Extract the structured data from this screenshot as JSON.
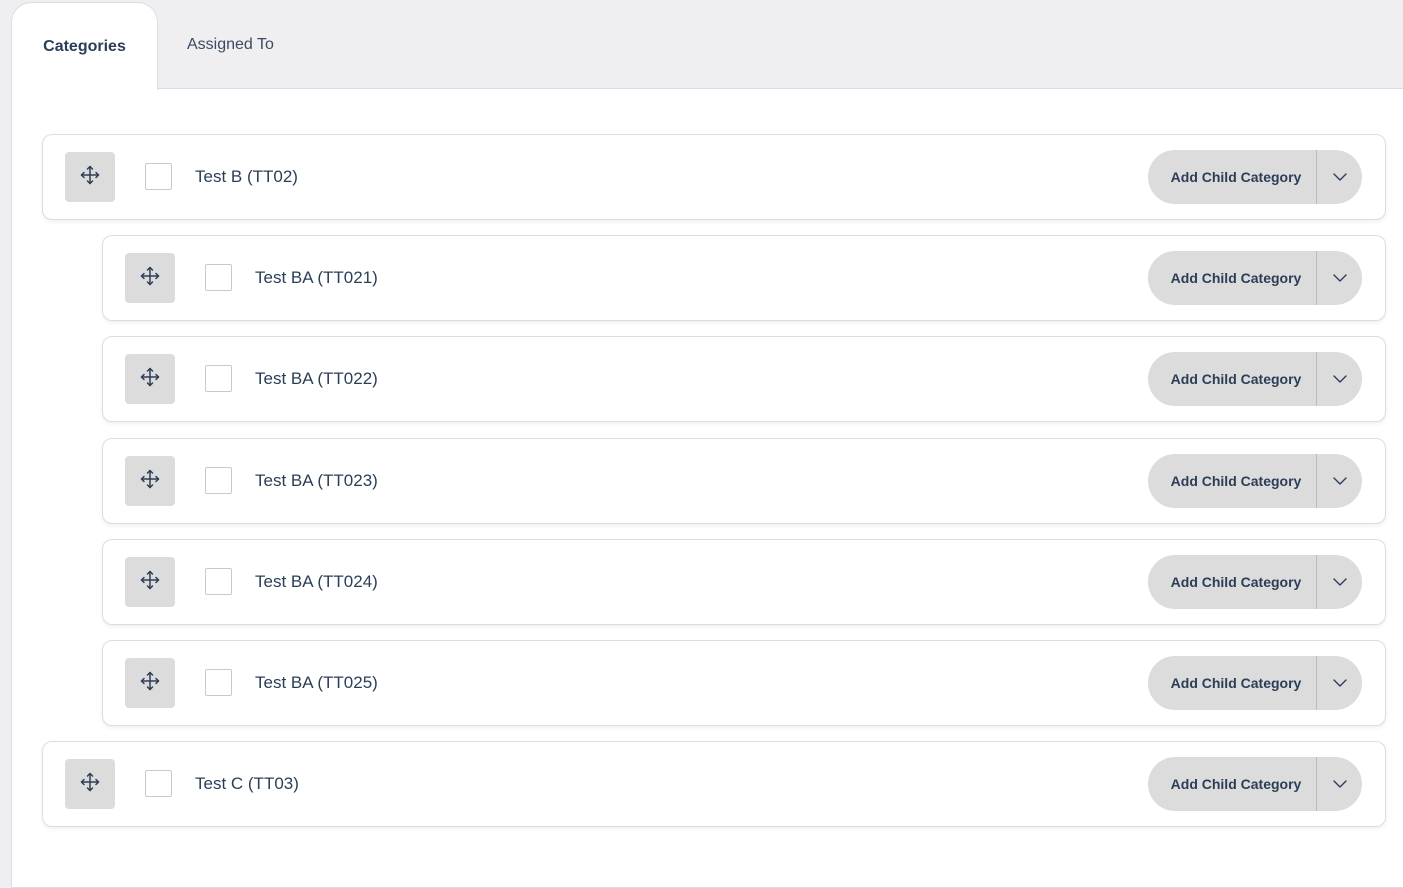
{
  "tabs": [
    {
      "label": "Categories",
      "active": true
    },
    {
      "label": "Assigned To",
      "active": false
    }
  ],
  "categories": [
    {
      "label": "Test B (TT02)",
      "level": 0,
      "action_label": "Add Child Category"
    },
    {
      "label": "Test BA (TT021)",
      "level": 1,
      "action_label": "Add Child Category"
    },
    {
      "label": "Test BA (TT022)",
      "level": 1,
      "action_label": "Add Child Category"
    },
    {
      "label": "Test BA (TT023)",
      "level": 1,
      "action_label": "Add Child Category"
    },
    {
      "label": "Test BA (TT024)",
      "level": 1,
      "action_label": "Add Child Category"
    },
    {
      "label": "Test BA (TT025)",
      "level": 1,
      "action_label": "Add Child Category"
    },
    {
      "label": "Test C (TT03)",
      "level": 0,
      "action_label": "Add Child Category"
    }
  ],
  "icons": {
    "drag": "move-icon",
    "toggle": "chevron-down-icon"
  },
  "colors": {
    "text": "#2c3e57",
    "button_bg": "#dcdcdc",
    "page_bg": "#efeff1"
  }
}
